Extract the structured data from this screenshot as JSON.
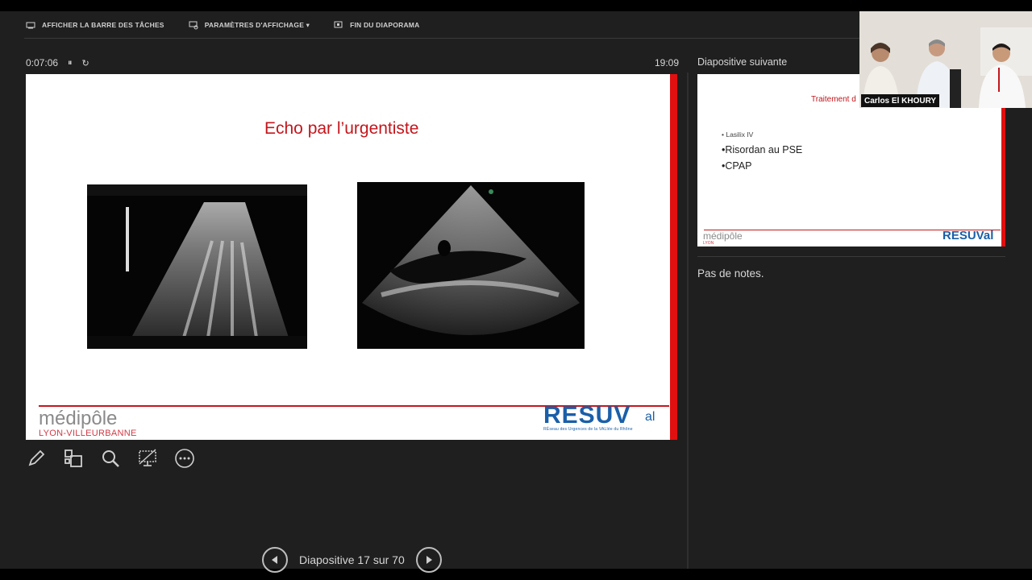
{
  "toolbar": {
    "taskbar_label": "AFFICHER LA BARRE DES TÂCHES",
    "display_settings_label": "PARAMÈTRES D'AFFICHAGE ▾",
    "end_show_label": "FIN DU DIAPORAMA"
  },
  "timer": {
    "elapsed": "0:07:06",
    "pause_glyph": "⏸",
    "reset_glyph": "↻",
    "clock": "19:09"
  },
  "slide": {
    "title": "Echo par l’urgentiste",
    "logo_left_main": "médipôle",
    "logo_left_sub": "LYON-VILLEURBANNE",
    "logo_right_main": "RESUV",
    "logo_right_suffix": "al",
    "logo_right_sub": "RÉseau des Urgences de la VALlée du Rhône"
  },
  "next": {
    "label": "Diapositive suivante",
    "title": "Traitement d",
    "bullets": [
      "• Lasilix IV",
      "•Risordan au PSE",
      "•CPAP"
    ],
    "logo_left": "médipôle",
    "logo_left_sub": "LYON",
    "logo_right": "RESUVal"
  },
  "notes": {
    "text": "Pas de notes."
  },
  "navigation": {
    "counter": "Diapositive 17 sur 70"
  },
  "video": {
    "participant_name": "Carlos El KHOURY"
  },
  "icons": [
    "taskbar-icon",
    "display-settings-icon",
    "end-show-icon",
    "pen-icon",
    "slides-grid-icon",
    "zoom-icon",
    "screen-black-icon",
    "more-options-icon",
    "prev-icon",
    "next-icon"
  ],
  "colors": {
    "accent_red": "#c4161c",
    "resuval_blue": "#1a5fa8",
    "panel_bg": "#1f1f1f"
  }
}
